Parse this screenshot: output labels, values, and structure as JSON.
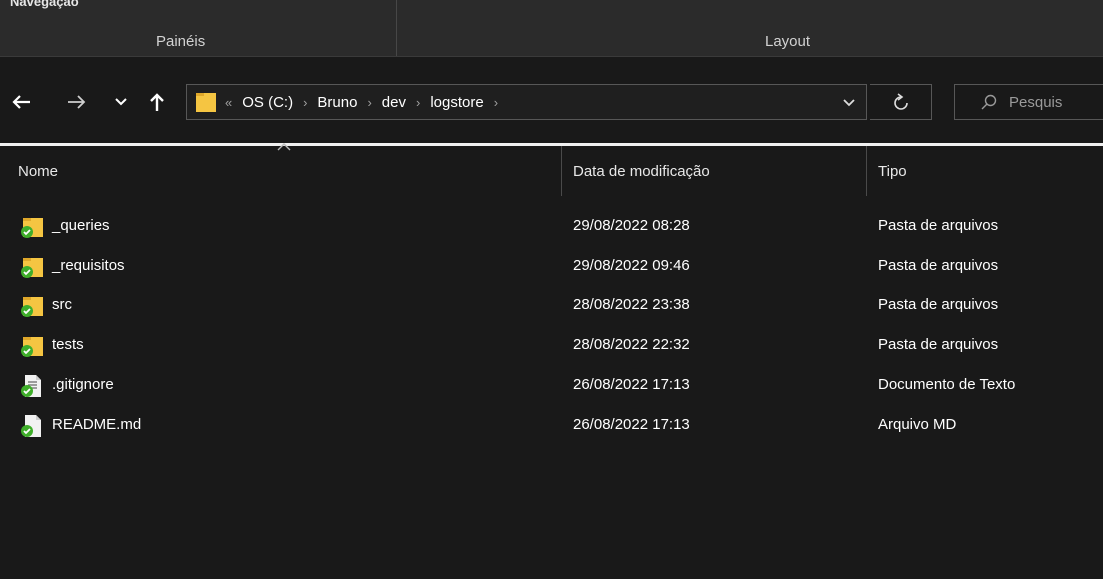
{
  "ribbon": {
    "cut_label": "Navegação",
    "groups": [
      "Painéis",
      "Layout"
    ]
  },
  "nav": {
    "back_icon": "arrow-left-icon",
    "forward_icon": "arrow-right-icon",
    "recent_icon": "chevron-down-icon",
    "up_icon": "arrow-up-icon"
  },
  "address": {
    "overflow": "«",
    "separator": "›",
    "crumbs": [
      "OS (C:)",
      "Bruno",
      "dev",
      "logstore"
    ]
  },
  "search": {
    "placeholder": "Pesquis"
  },
  "columns": {
    "name": "Nome",
    "date": "Data de modificação",
    "type": "Tipo"
  },
  "files": [
    {
      "icon": "folder-synced-icon",
      "name": "_queries",
      "date": "29/08/2022 08:28",
      "type": "Pasta de arquivos"
    },
    {
      "icon": "folder-synced-icon",
      "name": "_requisitos",
      "date": "29/08/2022 09:46",
      "type": "Pasta de arquivos"
    },
    {
      "icon": "folder-synced-icon",
      "name": "src",
      "date": "28/08/2022 23:38",
      "type": "Pasta de arquivos"
    },
    {
      "icon": "folder-synced-icon",
      "name": "tests",
      "date": "28/08/2022 22:32",
      "type": "Pasta de arquivos"
    },
    {
      "icon": "text-file-synced-icon",
      "name": ".gitignore",
      "date": "26/08/2022 17:13",
      "type": "Documento de Texto"
    },
    {
      "icon": "file-synced-icon",
      "name": "README.md",
      "date": "26/08/2022 17:13",
      "type": "Arquivo MD"
    }
  ],
  "colors": {
    "background": "#191919",
    "folder": "#f5c542",
    "sync_check": "#3fae2a"
  }
}
